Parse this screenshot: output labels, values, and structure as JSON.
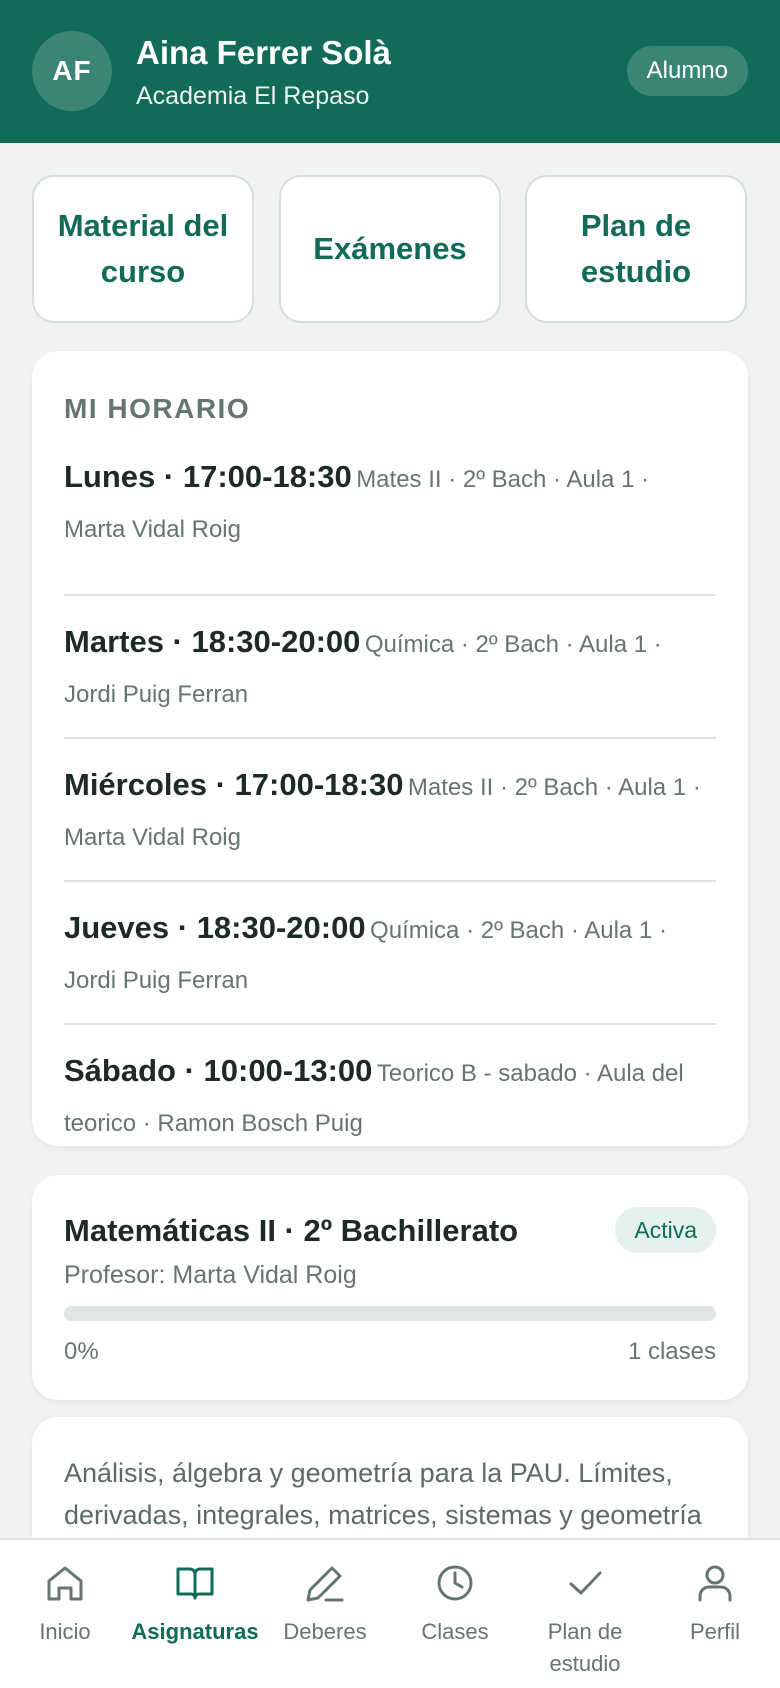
{
  "header": {
    "initials": "AF",
    "name": "Aina Ferrer Solà",
    "academy": "Academia El Repaso",
    "role": "Alumno",
    "brand_color": "#116b58"
  },
  "quick_actions": [
    {
      "label": "Material del curso"
    },
    {
      "label": "Exámenes"
    },
    {
      "label": "Plan de estudio"
    }
  ],
  "schedule": {
    "title": "MI HORARIO",
    "rows": [
      {
        "day_time": "Lunes · 17:00-18:30",
        "detail": "Mates II · 2º Bach · Aula 1 · Marta Vidal Roig"
      },
      {
        "day_time": "Martes · 18:30-20:00",
        "detail": "Química · 2º Bach · Aula 1 · Jordi Puig Ferran"
      },
      {
        "day_time": "Miércoles · 17:00-18:30",
        "detail": "Mates II · 2º Bach · Aula 1 · Marta Vidal Roig"
      },
      {
        "day_time": "Jueves · 18:30-20:00",
        "detail": "Química · 2º Bach · Aula 1 · Jordi Puig Ferran"
      },
      {
        "day_time": "Sábado · 10:00-13:00",
        "detail": "Teorico B - sabado · Aula del teorico · Ramon Bosch Puig"
      }
    ]
  },
  "course": {
    "title": "Matemáticas II · 2º Bachillerato",
    "status": "Activa",
    "teacher": "Profesor: Marta Vidal Roig",
    "progress_percent": 0,
    "progress_label": "0%",
    "classes_label": "1 clases"
  },
  "description": {
    "text": "Análisis, álgebra y geometría para la PAU. Límites, derivadas, integrales, matrices, sistemas y geometría"
  },
  "bottom_nav": [
    {
      "label": "Inicio",
      "icon": "home-icon",
      "active": false
    },
    {
      "label": "Asignaturas",
      "icon": "book-icon",
      "active": true
    },
    {
      "label": "Deberes",
      "icon": "pencil-icon",
      "active": false
    },
    {
      "label": "Clases",
      "icon": "clock-icon",
      "active": false
    },
    {
      "label": "Plan de estudio",
      "icon": "check-icon",
      "active": false
    },
    {
      "label": "Perfil",
      "icon": "user-icon",
      "active": false
    }
  ]
}
